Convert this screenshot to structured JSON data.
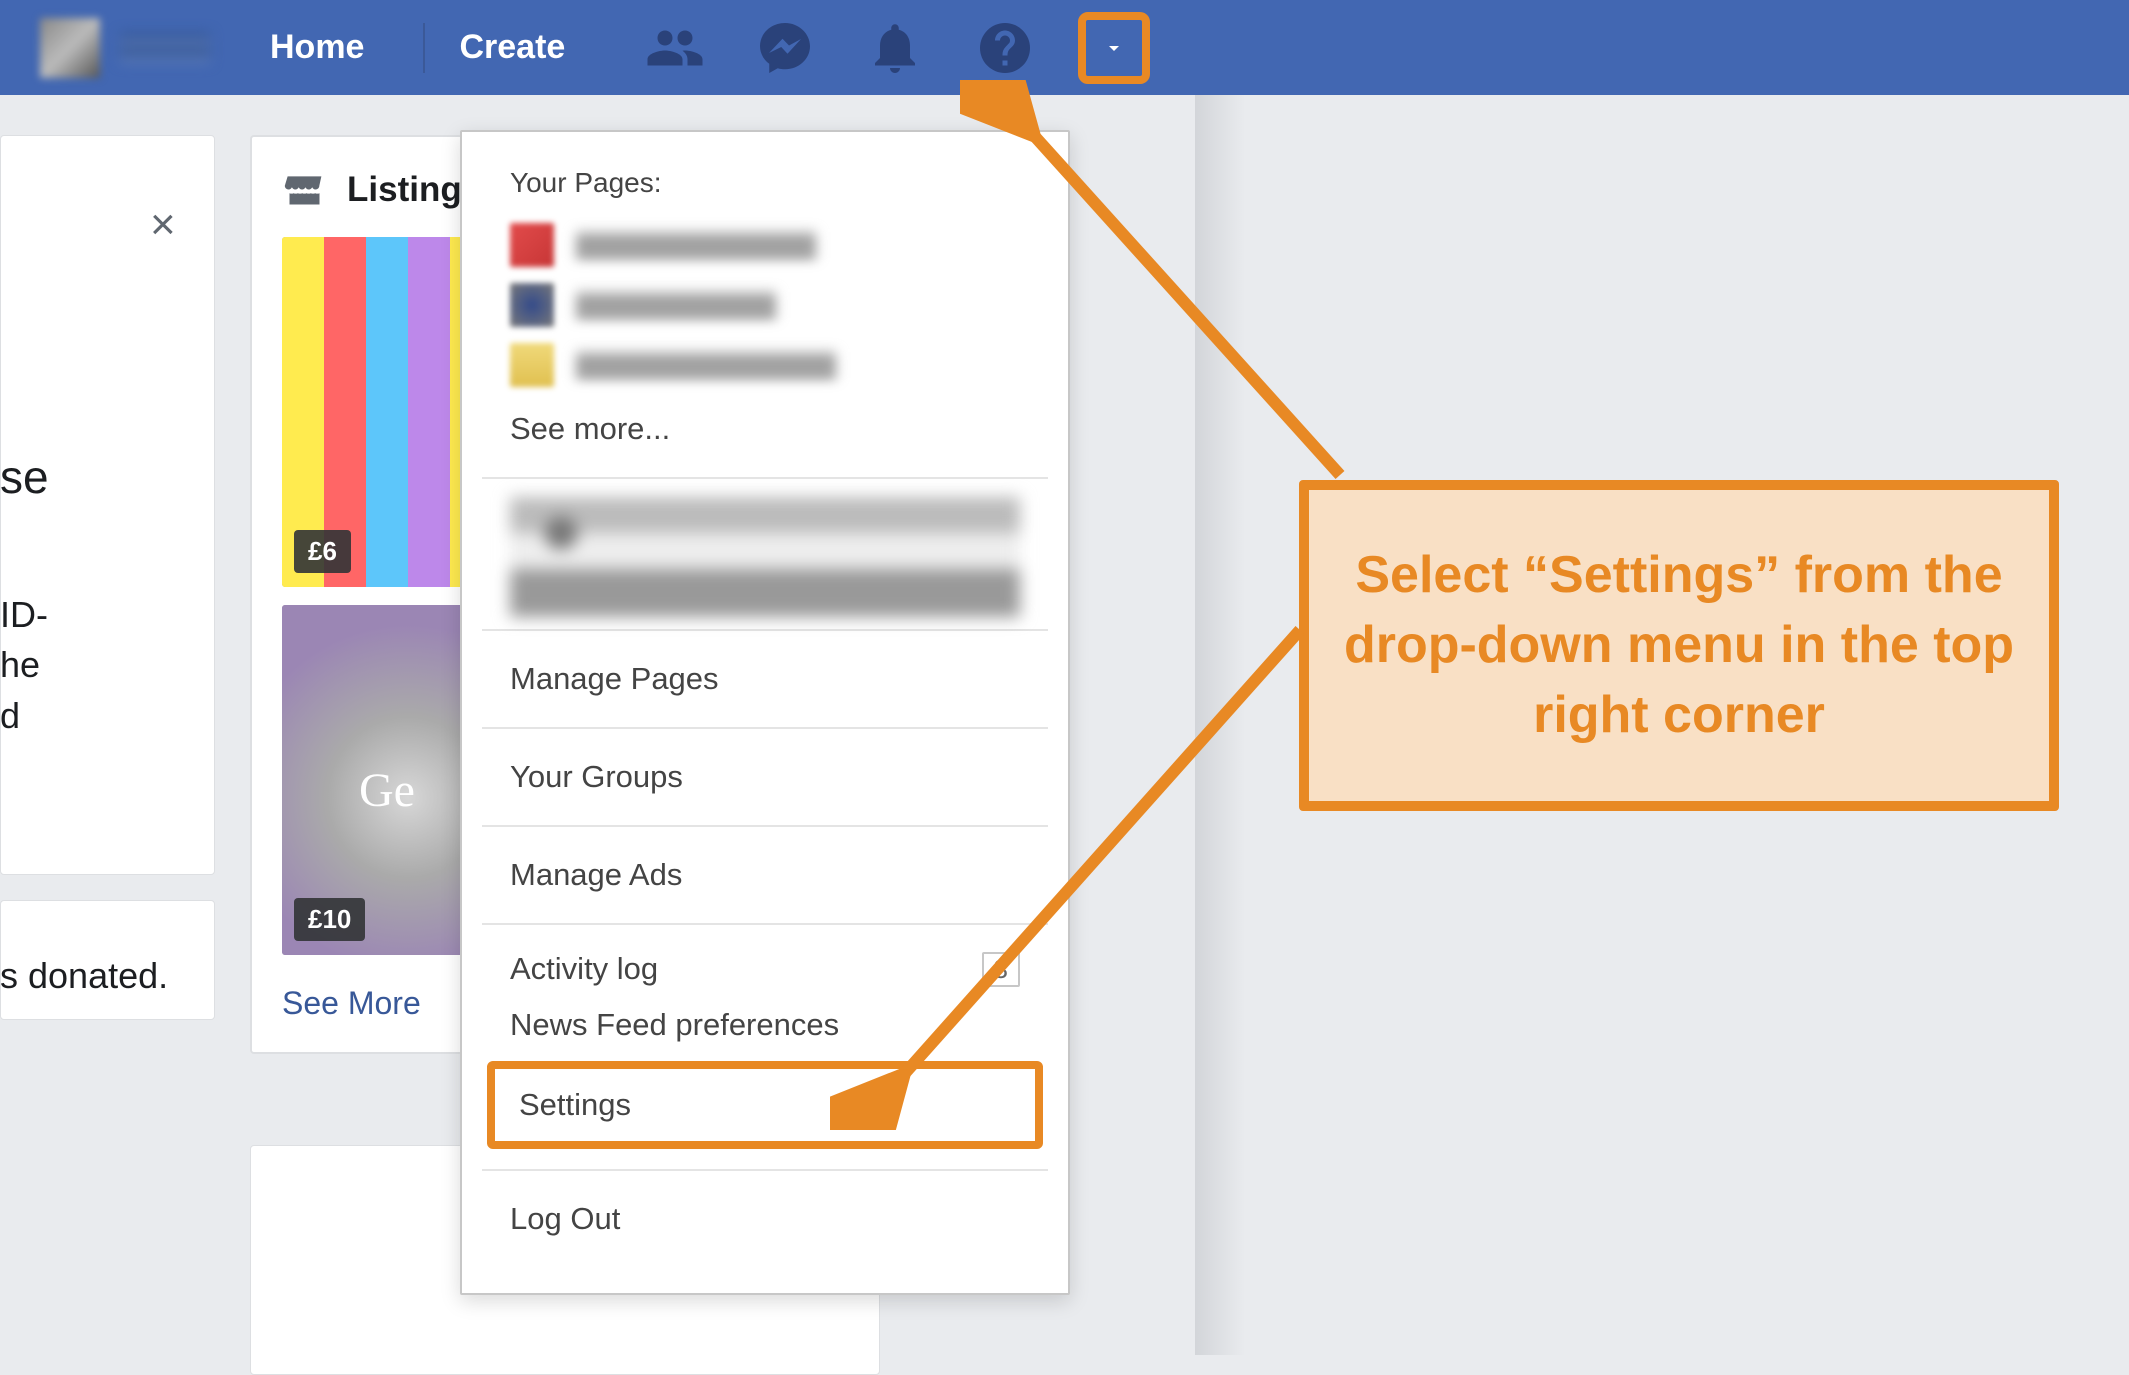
{
  "topbar": {
    "home": "Home",
    "create": "Create"
  },
  "listing": {
    "heading": "Listing",
    "price1": "£6",
    "price2": "£10",
    "see_more": "See More"
  },
  "left_fragments": {
    "se": "se",
    "id_line": "ID-\nhe\nd",
    "donated": "s donated."
  },
  "dropdown": {
    "your_pages": "Your Pages:",
    "see_more": "See more...",
    "manage_pages": "Manage Pages",
    "your_groups": "Your Groups",
    "manage_ads": "Manage Ads",
    "activity_log": "Activity log",
    "activity_count": "3",
    "news_feed_prefs": "News Feed preferences",
    "settings": "Settings",
    "log_out": "Log Out"
  },
  "callout": {
    "text": "Select “Settings” from the drop-down menu in the top right corner"
  }
}
